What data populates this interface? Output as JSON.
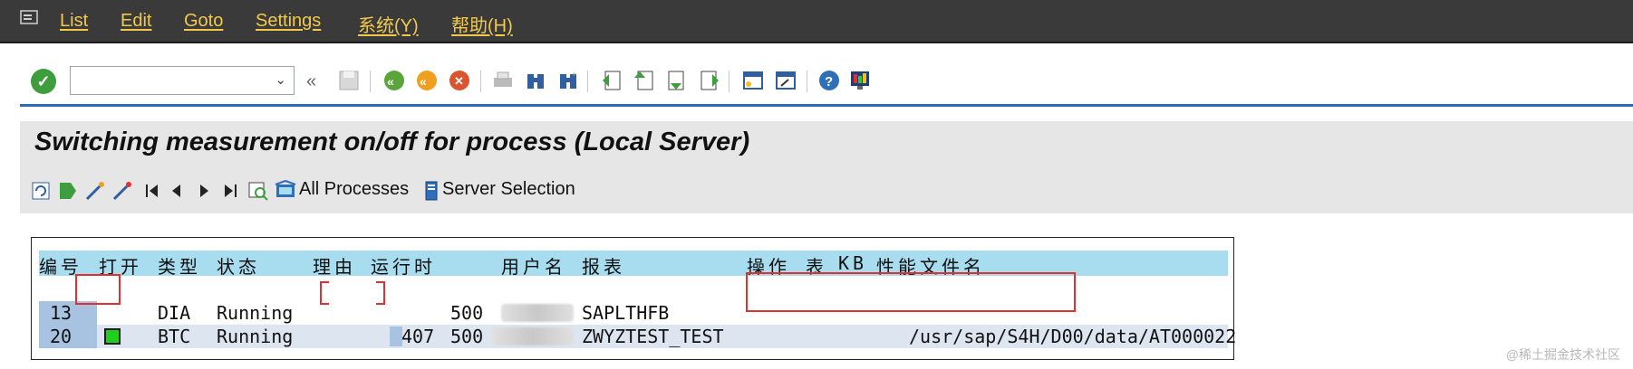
{
  "menubar": {
    "items": [
      "List",
      "Edit",
      "Goto",
      "Settings",
      "系统(Y)",
      "帮助(H)"
    ]
  },
  "toolbar": {
    "command_field_value": "",
    "icons": [
      "ok-icon",
      "back-icon",
      "exit-icon",
      "cancel-icon",
      "print-icon",
      "find-icon",
      "find-next-icon",
      "first-page-icon",
      "previous-page-icon",
      "next-page-icon",
      "last-page-icon",
      "new-session-icon",
      "shortcut-icon",
      "help-icon",
      "layout-icon"
    ]
  },
  "title": "Switching measurement on/off for process (Local Server)",
  "app_toolbar": {
    "all_processes_label": "All Processes",
    "server_selection_label": "Server Selection"
  },
  "list": {
    "headers": [
      "编号",
      "打开",
      "类型",
      "状态",
      "理由",
      "运行时",
      "用户名",
      "报表",
      "操作",
      "表",
      "KB",
      "性能文件名"
    ],
    "rows": [
      {
        "no": "13",
        "type": "DIA",
        "status": "Running",
        "runtime": "",
        "client": "500",
        "report": "SAPLTHFB",
        "file": ""
      },
      {
        "no": "20",
        "type": "BTC",
        "status": "Running",
        "runtime": "407",
        "client": "500",
        "report": "ZWYZTEST_TEST",
        "file": "/usr/sap/S4H/D00/data/AT000022"
      }
    ]
  },
  "watermark": "@稀土掘金技术社区",
  "colors": {
    "menu_bg": "#3a3a3a",
    "menu_text": "#f2c94c",
    "header_bg": "#a8dcef",
    "highlight_red": "#e03030",
    "accent_blue": "#2a6db4"
  }
}
